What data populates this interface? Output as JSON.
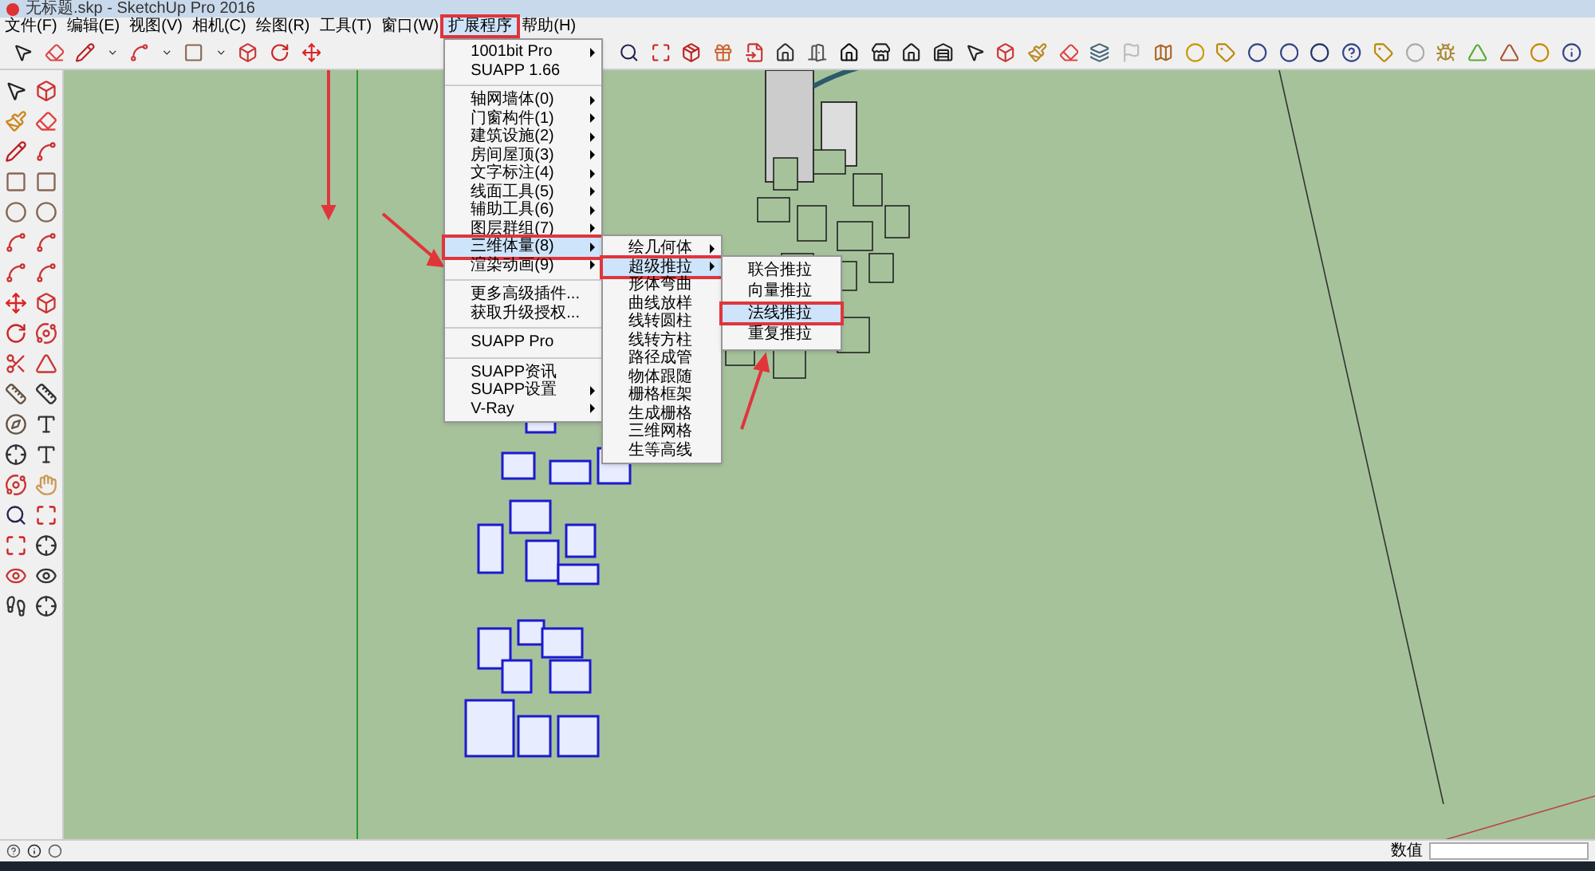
{
  "window": {
    "title": "无标题.skp - SketchUp Pro 2016"
  },
  "menu_bar": [
    {
      "label": "文件(F)",
      "selected": false
    },
    {
      "label": "编辑(E)",
      "selected": false
    },
    {
      "label": "视图(V)",
      "selected": false
    },
    {
      "label": "相机(C)",
      "selected": false
    },
    {
      "label": "绘图(R)",
      "selected": false
    },
    {
      "label": "工具(T)",
      "selected": false
    },
    {
      "label": "窗口(W)",
      "selected": false
    },
    {
      "label": "扩展程序",
      "selected": true
    },
    {
      "label": "帮助(H)",
      "selected": false
    }
  ],
  "extensions_menu": {
    "sections": [
      [
        {
          "label": "1001bit Pro",
          "submenu": true,
          "selected": false
        },
        {
          "label": "SUAPP 1.66",
          "submenu": false,
          "selected": false
        }
      ],
      [
        {
          "label": "轴网墙体(0)",
          "submenu": true,
          "selected": false
        },
        {
          "label": "门窗构件(1)",
          "submenu": true,
          "selected": false
        },
        {
          "label": "建筑设施(2)",
          "submenu": true,
          "selected": false
        },
        {
          "label": "房间屋顶(3)",
          "submenu": true,
          "selected": false
        },
        {
          "label": "文字标注(4)",
          "submenu": true,
          "selected": false
        },
        {
          "label": "线面工具(5)",
          "submenu": true,
          "selected": false
        },
        {
          "label": "辅助工具(6)",
          "submenu": true,
          "selected": false
        },
        {
          "label": "图层群组(7)",
          "submenu": true,
          "selected": false
        },
        {
          "label": "三维体量(8)",
          "submenu": true,
          "selected": true
        },
        {
          "label": "渲染动画(9)",
          "submenu": true,
          "selected": false
        }
      ],
      [
        {
          "label": "更多高级插件...",
          "submenu": false,
          "selected": false
        },
        {
          "label": "获取升级授权...",
          "submenu": false,
          "selected": false
        }
      ],
      [
        {
          "label": "SUAPP Pro",
          "submenu": false,
          "selected": false
        }
      ],
      [
        {
          "label": "SUAPP资讯",
          "submenu": false,
          "selected": false
        },
        {
          "label": "SUAPP设置",
          "submenu": true,
          "selected": false
        },
        {
          "label": "V-Ray",
          "submenu": true,
          "selected": false
        }
      ]
    ]
  },
  "volume_submenu": [
    {
      "label": "绘几何体",
      "submenu": true,
      "selected": false
    },
    {
      "label": "超级推拉",
      "submenu": true,
      "selected": true
    },
    {
      "label": "形体弯曲",
      "submenu": false,
      "selected": false
    },
    {
      "label": "曲线放样",
      "submenu": false,
      "selected": false
    },
    {
      "label": "线转圆柱",
      "submenu": false,
      "selected": false
    },
    {
      "label": "线转方柱",
      "submenu": false,
      "selected": false
    },
    {
      "label": "路径成管",
      "submenu": false,
      "selected": false
    },
    {
      "label": "物体跟随",
      "submenu": false,
      "selected": false
    },
    {
      "label": "栅格框架",
      "submenu": false,
      "selected": false
    },
    {
      "label": "生成栅格",
      "submenu": false,
      "selected": false
    },
    {
      "label": "三维网格",
      "submenu": false,
      "selected": false
    },
    {
      "label": "生等高线",
      "submenu": false,
      "selected": false
    }
  ],
  "push_pull_submenu": [
    {
      "label": "联合推拉",
      "selected": false
    },
    {
      "label": "向量推拉",
      "selected": false
    },
    {
      "label": "法线推拉",
      "selected": true
    },
    {
      "label": "重复推拉",
      "selected": false
    }
  ],
  "status_bar": {
    "measurements_label": "数值"
  }
}
